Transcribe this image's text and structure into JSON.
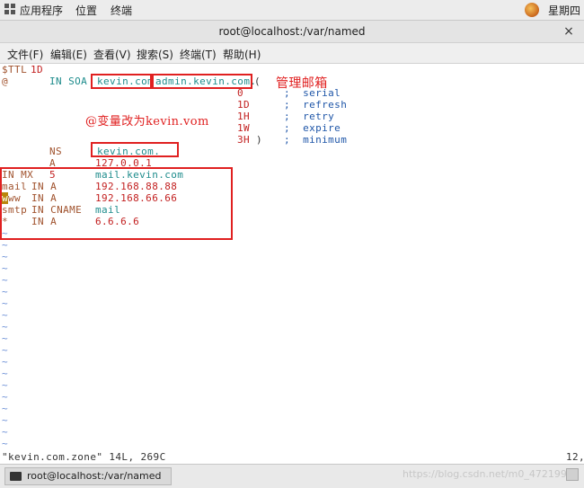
{
  "top_panel": {
    "applications": "应用程序",
    "places": "位置",
    "terminal": "终端",
    "clock": "星期四"
  },
  "window": {
    "title": "root@localhost:/var/named",
    "close": "×"
  },
  "menubar": {
    "file": "文件(F)",
    "edit": "编辑(E)",
    "view": "查看(V)",
    "search": "搜索(S)",
    "terminal": "终端(T)",
    "help": "帮助(H)"
  },
  "editor": {
    "ttl_keyword": "$TTL",
    "ttl_value": "1D",
    "soa_at": "@",
    "soa_in": "IN SOA",
    "soa_domain": "kevin.com",
    "soa_email": "admin.kevin.com.",
    "soa_paren": "(",
    "serial_val": "0",
    "serial_label": ";  serial",
    "refresh_val": "1D",
    "refresh_label": ";  refresh",
    "retry_val": "1H",
    "retry_label": ";  retry",
    "expire_val": "1W",
    "expire_label": ";  expire",
    "minimum_val": "3H",
    "minimum_close": ")",
    "minimum_label": ";  minimum",
    "ns_type": "NS",
    "ns_value": "kevin.com.",
    "a_type": "A",
    "a_value": "127.0.0.1",
    "mx_name": "IN MX",
    "mx_pref": "5",
    "mx_value": "mail.kevin.com",
    "mail_name": "mail",
    "mail_in": "IN A",
    "mail_value": "192.168.88.88",
    "www_cursor": "w",
    "www_rest": "ww",
    "www_in": "IN A",
    "www_value": "192.168.66.66",
    "smtp_name": "smtp",
    "smtp_in": "IN CNAME",
    "smtp_value": "mail",
    "wild_name": "*",
    "wild_in": "IN A",
    "wild_value": "6.6.6.6",
    "tilde": "~",
    "status_file": "\"kevin.com.zone\" 14L, 269C",
    "status_pos": "12,"
  },
  "annotations": {
    "admin_mailbox": "管理邮箱",
    "change_note": "@变量改为kevin.vom"
  },
  "taskbar": {
    "window_label": "root@localhost:/var/named",
    "watermark": "https://blog.csdn.net/m0_47219942"
  }
}
